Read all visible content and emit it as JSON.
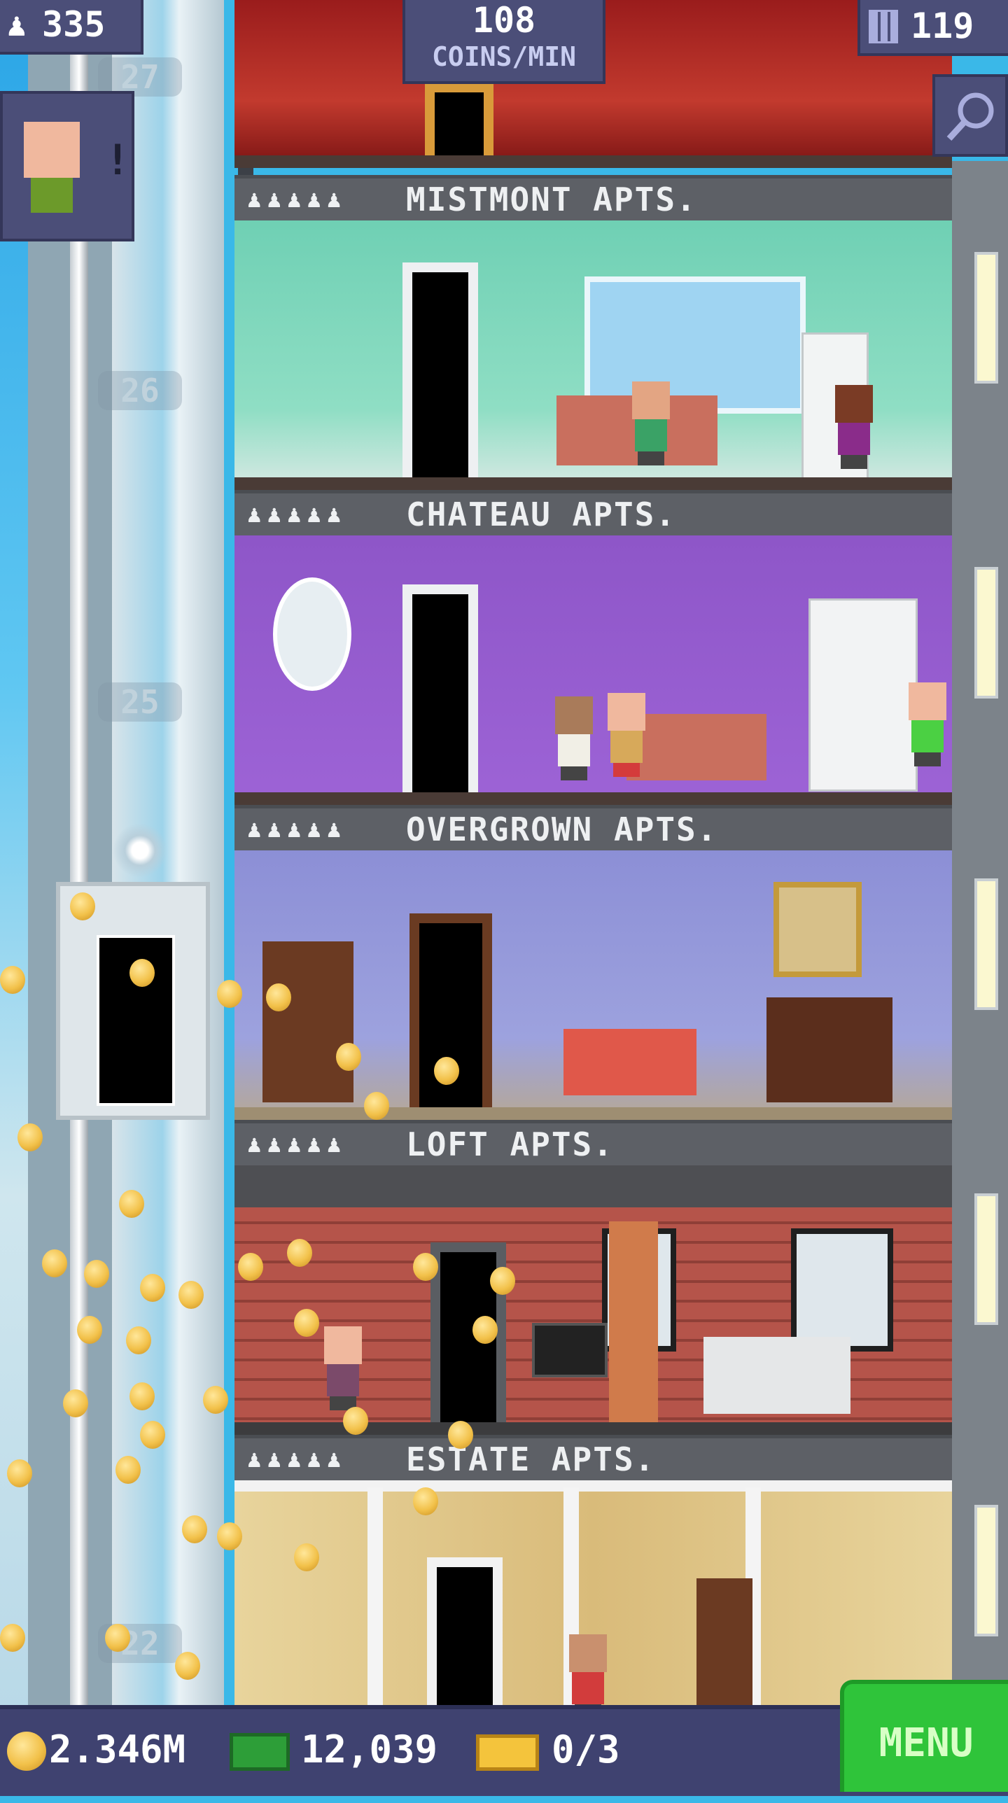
{
  "hud": {
    "population": "335",
    "coins_per_min_value": "108",
    "coins_per_min_label": "COINS/MIN",
    "floors": "119"
  },
  "shaft": {
    "floor_numbers": [
      "27",
      "26",
      "25",
      "22"
    ]
  },
  "floors": [
    {
      "name": "MISTMONT APTS.",
      "residents": "♟♟♟♟♟"
    },
    {
      "name": "CHATEAU APTS.",
      "residents": "♟♟♟♟♟"
    },
    {
      "name": "OVERGROWN APTS.",
      "residents": "♟♟♟♟♟"
    },
    {
      "name": "LOFT APTS.",
      "residents": "♟♟♟♟♟"
    },
    {
      "name": "ESTATE APTS.",
      "residents": "♟♟♟♟♟"
    }
  ],
  "bottom_bar": {
    "coins": "2.346M",
    "bux": "12,039",
    "tickets": "0/3",
    "menu_label": "MENU"
  },
  "icons": [
    "person-icon",
    "floors-icon",
    "search-icon",
    "coin-icon",
    "bux-icon",
    "ticket-icon"
  ],
  "colors": {
    "hud_bg": "#4b4e78",
    "menu_green": "#2fc43a",
    "banner_gray": "#5d6066",
    "coin_gold": "#f2c14a"
  }
}
